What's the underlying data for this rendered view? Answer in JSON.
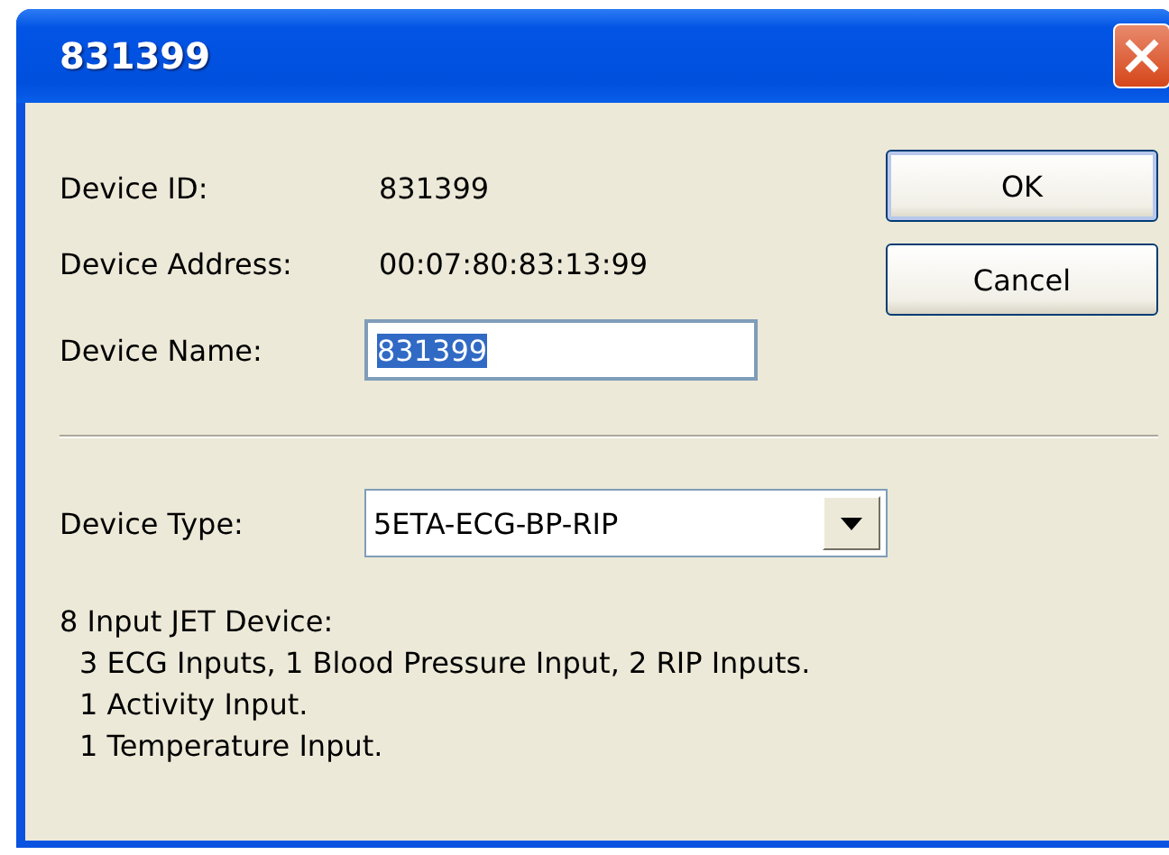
{
  "window": {
    "title": "831399"
  },
  "fields": [
    {
      "kind": "text",
      "label": "Device ID:",
      "value": "831399"
    },
    {
      "kind": "text",
      "label": "Device Address:",
      "value": "00:07:80:83:13:99"
    },
    {
      "kind": "input",
      "label": "Device Name:",
      "value": "831399",
      "selected": true
    }
  ],
  "buttons": [
    {
      "label": "OK",
      "default": true
    },
    {
      "label": "Cancel",
      "default": false
    }
  ],
  "device_type": {
    "label": "Device Type:",
    "value": "5ETA-ECG-BP-RIP"
  },
  "description": {
    "heading": "8 Input JET Device:",
    "lines": [
      "3 ECG Inputs, 1 Blood Pressure Input, 2 RIP Inputs.",
      "1 Activity Input.",
      "1 Temperature Input."
    ]
  }
}
